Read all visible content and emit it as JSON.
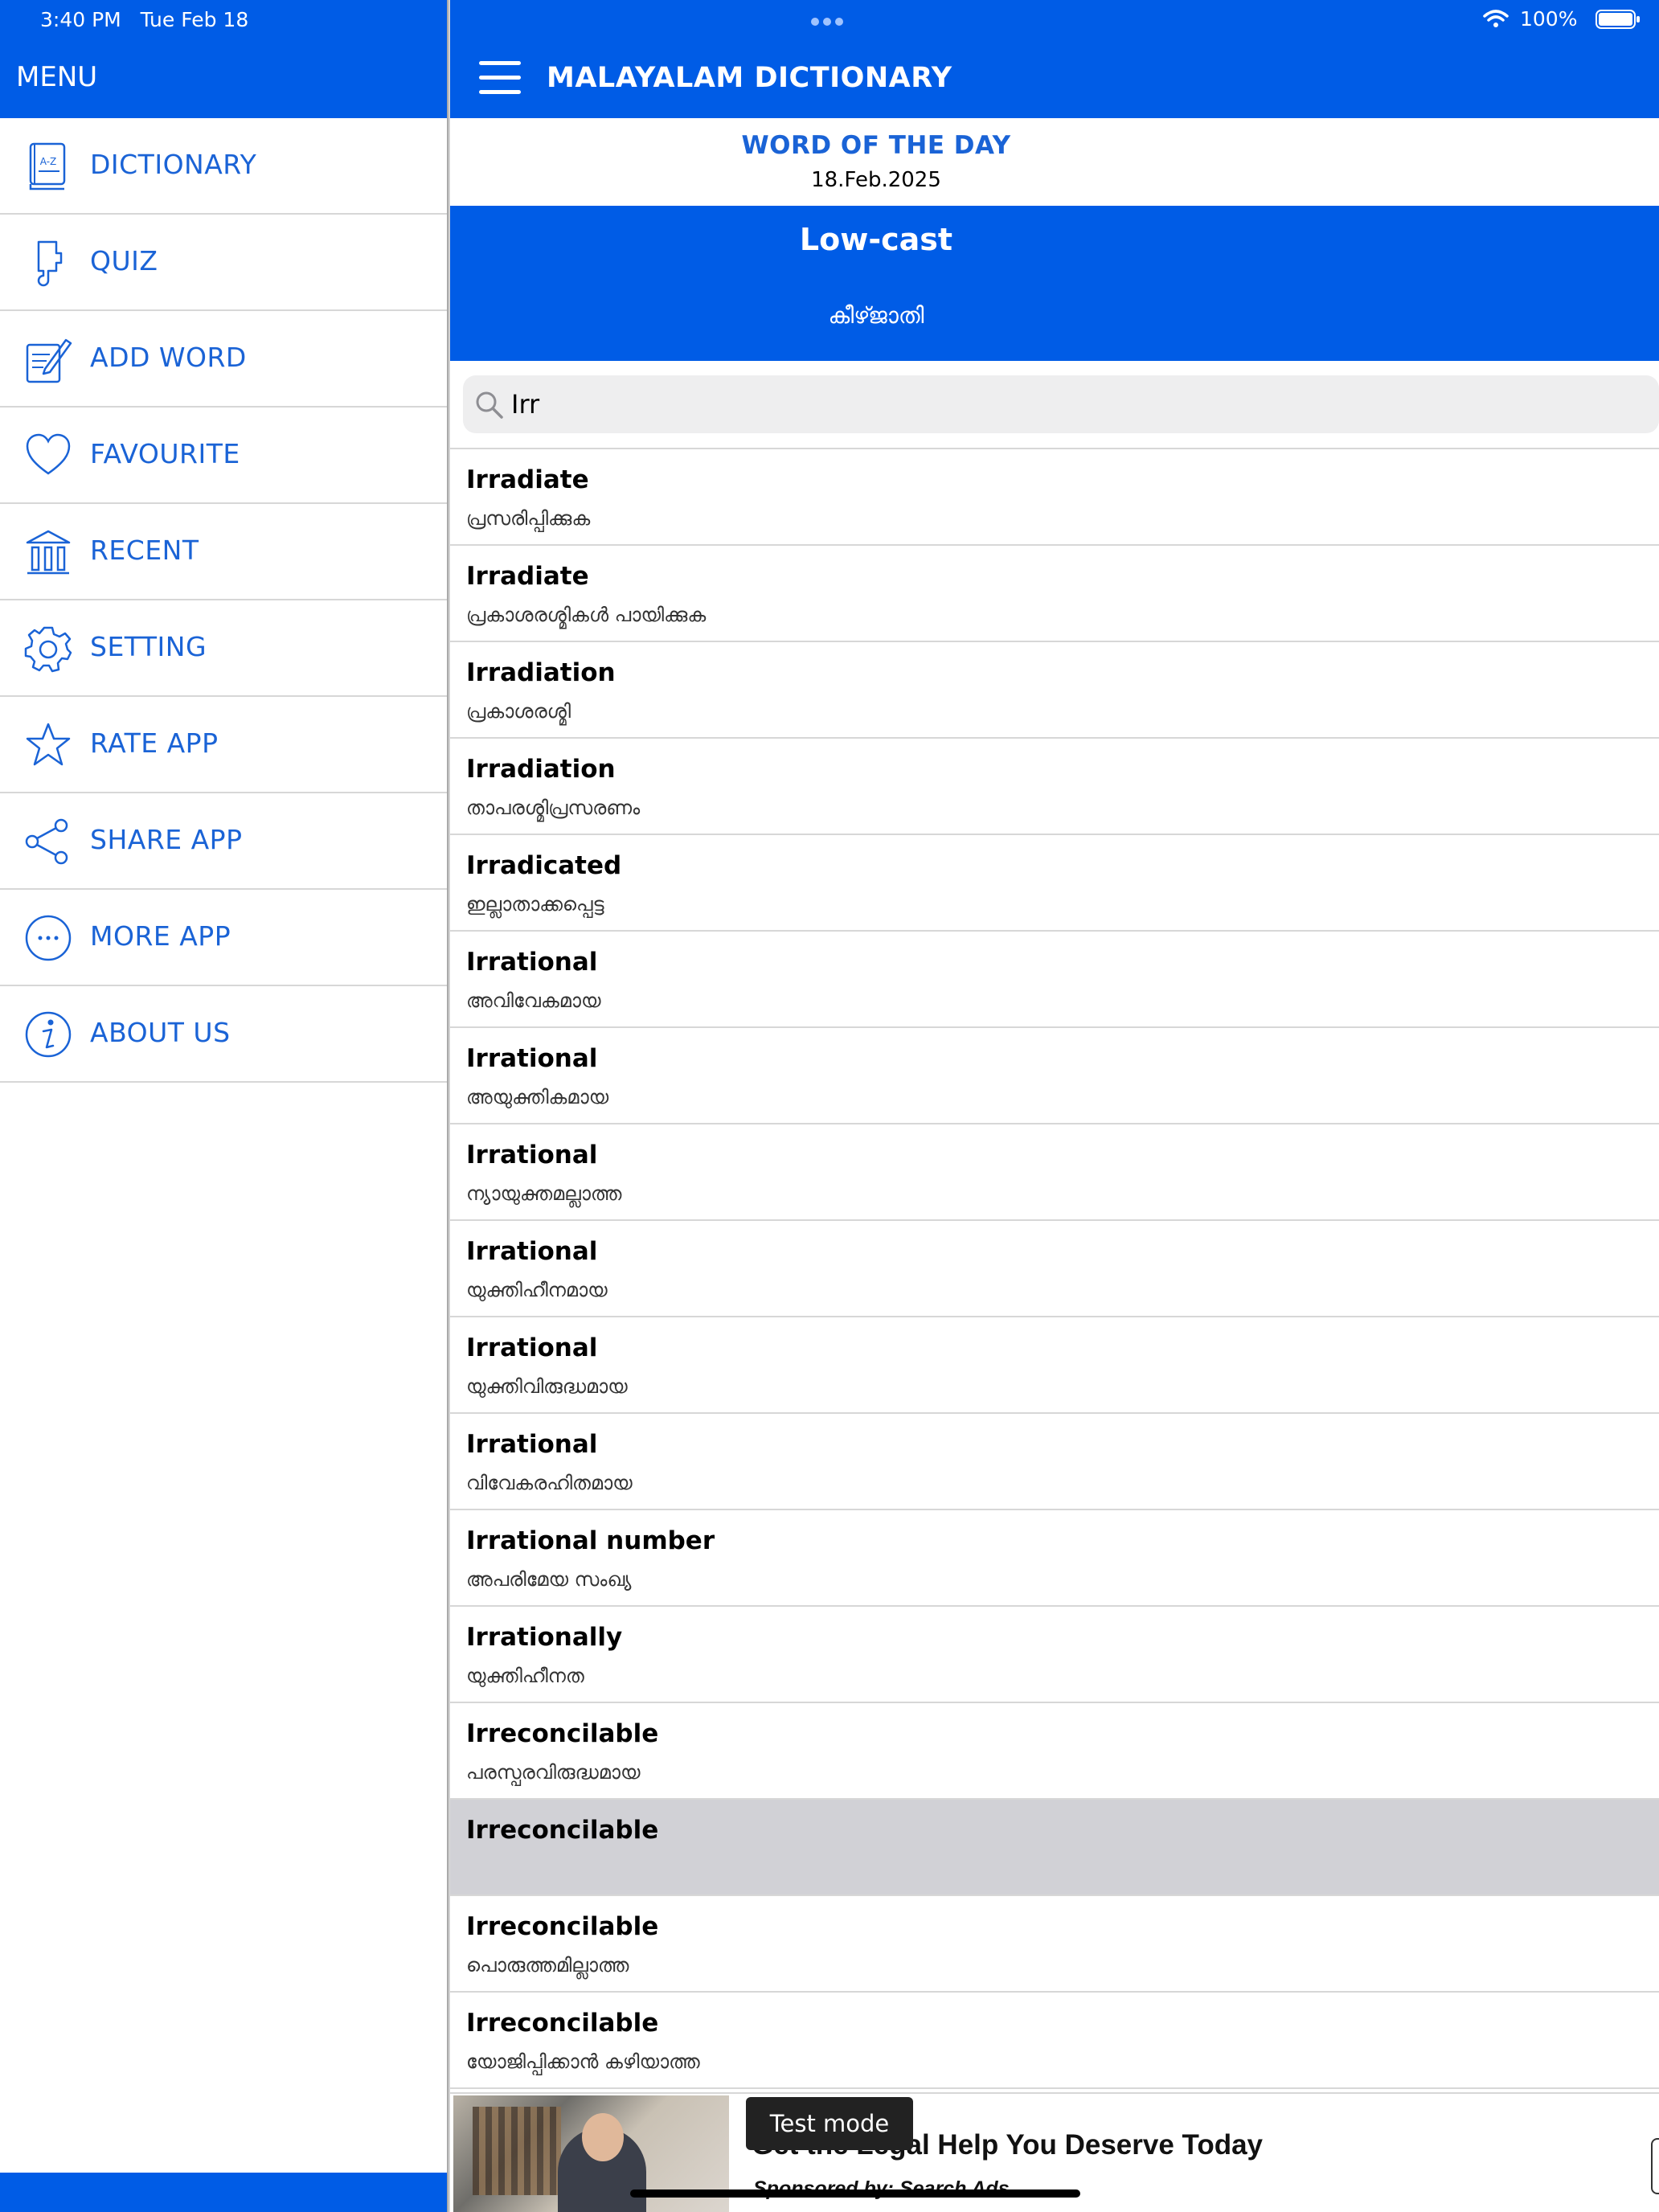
{
  "status_bar": {
    "time": "3:40 PM   Tue Feb 18",
    "battery_percent": "100%"
  },
  "sidebar": {
    "title": "MENU",
    "items": [
      {
        "label": "DICTIONARY",
        "icon": "dictionary-icon"
      },
      {
        "label": "QUIZ",
        "icon": "quiz-icon"
      },
      {
        "label": "ADD WORD",
        "icon": "add-word-icon"
      },
      {
        "label": "FAVOURITE",
        "icon": "heart-icon"
      },
      {
        "label": "RECENT",
        "icon": "recent-icon"
      },
      {
        "label": "SETTING",
        "icon": "gear-icon"
      },
      {
        "label": "RATE APP",
        "icon": "star-icon"
      },
      {
        "label": "SHARE APP",
        "icon": "share-icon"
      },
      {
        "label": "MORE APP",
        "icon": "more-icon"
      },
      {
        "label": "ABOUT US",
        "icon": "info-icon"
      }
    ]
  },
  "header": {
    "title": "MALAYALAM DICTIONARY"
  },
  "word_of_the_day": {
    "heading": "WORD OF THE DAY",
    "date": "18.Feb.2025",
    "word": "Low-cast",
    "meaning": "കീഴ്ജാതി"
  },
  "search": {
    "value": "Irr"
  },
  "results": [
    {
      "word": "Irradiate",
      "meaning": "പ്രസരിപ്പിക്കുക"
    },
    {
      "word": "Irradiate",
      "meaning": "പ്രകാശരശ്മികൾ പായിക്കുക"
    },
    {
      "word": "Irradiation",
      "meaning": "പ്രകാശരശ്മി"
    },
    {
      "word": "Irradiation",
      "meaning": "താപരശ്മിപ്രസരണം"
    },
    {
      "word": "Irradicated",
      "meaning": "ഇല്ലാതാക്കപ്പെട്ട"
    },
    {
      "word": "Irrational",
      "meaning": "അവിവേകമായ"
    },
    {
      "word": "Irrational",
      "meaning": "അയുക്തികമായ"
    },
    {
      "word": "Irrational",
      "meaning": "ന്യായുക്തമല്ലാത്ത"
    },
    {
      "word": "Irrational",
      "meaning": "യുക്തിഹീനമായ"
    },
    {
      "word": "Irrational",
      "meaning": "യുക്തിവിരുദ്ധമായ"
    },
    {
      "word": "Irrational",
      "meaning": "വിവേകരഹിതമായ"
    },
    {
      "word": "Irrational number",
      "meaning": "അപരിമേയ സംഖ്യ"
    },
    {
      "word": "Irrationally",
      "meaning": "യുക്തിഹീനത"
    },
    {
      "word": "Irreconcilable",
      "meaning": "പരസ്പരവിരുദ്ധമായ"
    },
    {
      "word": "Irreconcilable",
      "meaning": "",
      "selected": true
    },
    {
      "word": "Irreconcilable",
      "meaning": "പൊരുത്തമില്ലാത്ത"
    },
    {
      "word": "Irreconcilable",
      "meaning": "യോജിപ്പിക്കാൻ കഴിയാത്ത"
    }
  ],
  "ad": {
    "headline": "Get the Legal Help You Deserve Today",
    "sponsor": "Sponsored by: Search Ads"
  },
  "toast": {
    "text": "Test mode"
  },
  "colors": {
    "brand_blue": "#005ce6",
    "menu_text": "#1a63d6",
    "selected_row": "#d1d1d6"
  }
}
